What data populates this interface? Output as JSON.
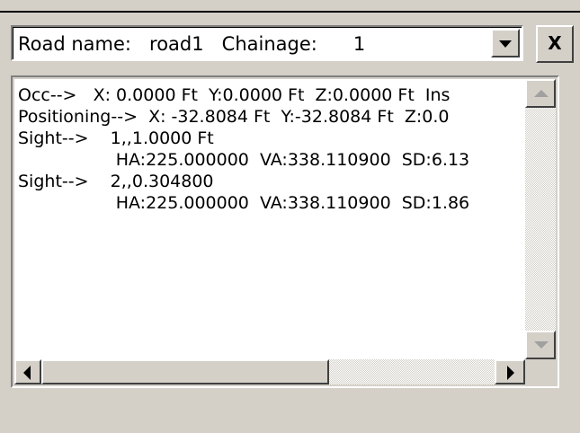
{
  "header": {
    "road_label": "Road name:",
    "road_value": "road1",
    "chainage_label": "Chainage:",
    "chainage_value": "1",
    "close_label": "X"
  },
  "log": {
    "lines": [
      "Occ-->   X: 0.0000 Ft  Y:0.0000 Ft  Z:0.0000 Ft  Ins",
      "Positioning-->  X: -32.8084 Ft  Y:-32.8084 Ft  Z:0.0",
      "Sight-->    1,,1.0000 Ft",
      "                  HA:225.000000  VA:338.110900  SD:6.13",
      "Sight-->    2,,0.304800",
      "                  HA:225.000000  VA:338.110900  SD:1.86"
    ]
  },
  "scroll": {
    "horizontal_thumb_fraction_visible": 0.55
  },
  "colors": {
    "background": "#d4d0c8",
    "content_background": "#ffffff",
    "text": "#000000"
  },
  "icons": {
    "combo_dropdown": "chevron-down-icon",
    "scroll_up": "arrow-up-icon",
    "scroll_down": "arrow-down-icon",
    "scroll_left": "arrow-left-icon",
    "scroll_right": "arrow-right-icon"
  }
}
